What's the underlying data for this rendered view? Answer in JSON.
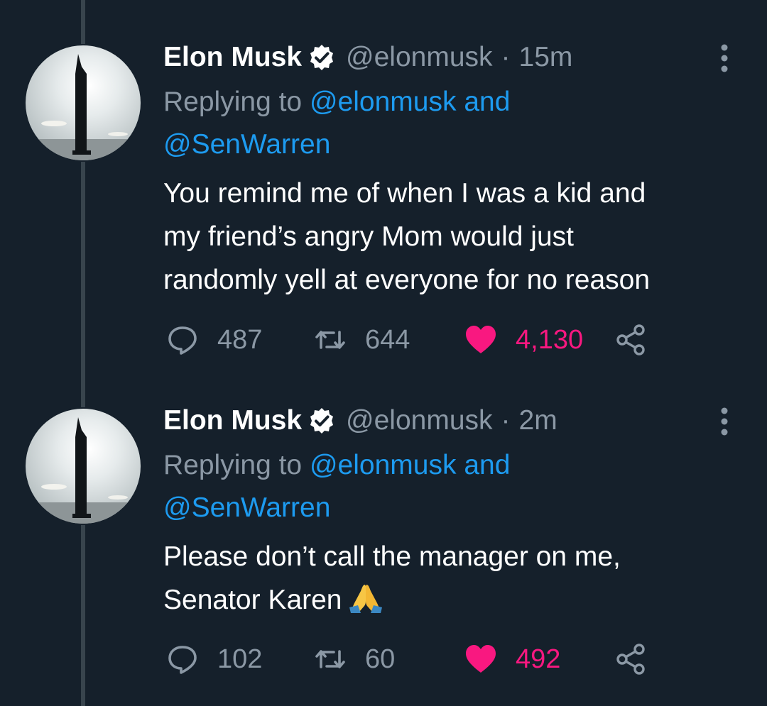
{
  "thread": {
    "line_color": "#38444d",
    "accent_color": "#1d9bf0",
    "like_color": "#f91880"
  },
  "tweets": [
    {
      "author_name": "Elon Musk",
      "verified": true,
      "handle": "@elonmusk",
      "separator": "·",
      "time": "15m",
      "replying_prefix": "Replying to",
      "replying_mention_1": "@elonmusk",
      "replying_and": "and",
      "replying_mention_2": "@SenWarren",
      "text": "You remind me of when I was a kid and\nmy friend’s angry Mom would just\nrandomly yell at everyone for no reason",
      "emoji": "",
      "replies": "487",
      "retweets": "644",
      "likes": "4,130",
      "liked": true
    },
    {
      "author_name": "Elon Musk",
      "verified": true,
      "handle": "@elonmusk",
      "separator": "·",
      "time": "2m",
      "replying_prefix": "Replying to",
      "replying_mention_1": "@elonmusk",
      "replying_and": "and",
      "replying_mention_2": "@SenWarren",
      "text": "Please don’t call the manager on me,\nSenator Karen",
      "emoji": "folded-hands-emoji",
      "replies": "102",
      "retweets": "60",
      "likes": "492",
      "liked": true
    }
  ]
}
